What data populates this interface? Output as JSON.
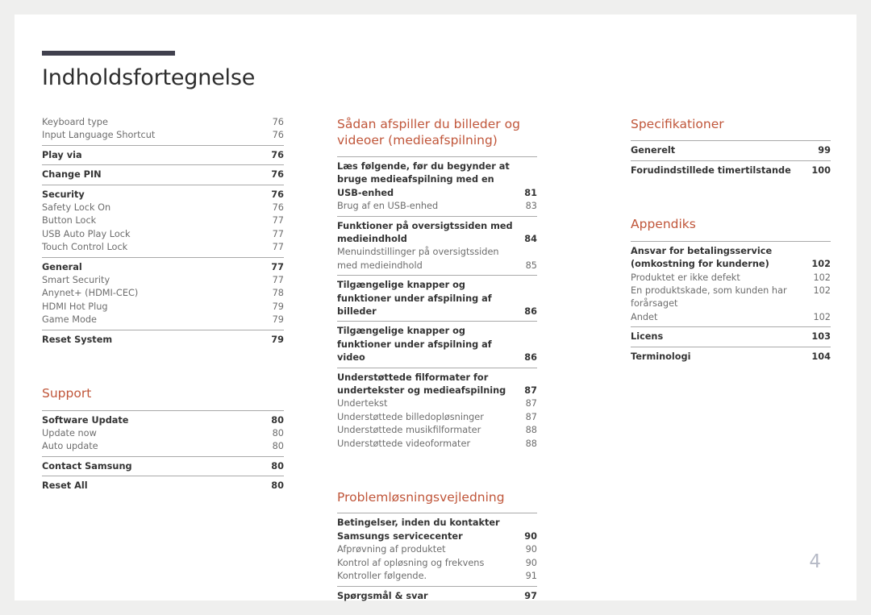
{
  "document": {
    "title": "Indholdsfortegnelse",
    "page_number": "4",
    "accent_color": "#c0563a",
    "rule_color": "#40404d",
    "page_number_color": "#b6bac6"
  },
  "columns": {
    "left": {
      "sections": [
        {
          "heading": null,
          "groups": [
            {
              "rule": false,
              "entries": [
                {
                  "level": 2,
                  "label": "Keyboard type",
                  "page": "76"
                },
                {
                  "level": 2,
                  "label": "Input Language Shortcut",
                  "page": "76"
                }
              ]
            },
            {
              "rule": true,
              "entries": [
                {
                  "level": 1,
                  "label": "Play via",
                  "page": "76"
                }
              ]
            },
            {
              "rule": true,
              "entries": [
                {
                  "level": 1,
                  "label": "Change PIN",
                  "page": "76"
                }
              ]
            },
            {
              "rule": true,
              "entries": [
                {
                  "level": 1,
                  "label": "Security",
                  "page": "76"
                },
                {
                  "level": 2,
                  "label": "Safety Lock On",
                  "page": "76"
                },
                {
                  "level": 2,
                  "label": "Button Lock",
                  "page": "77"
                },
                {
                  "level": 2,
                  "label": "USB Auto Play Lock",
                  "page": "77"
                },
                {
                  "level": 2,
                  "label": "Touch Control Lock",
                  "page": "77"
                }
              ]
            },
            {
              "rule": true,
              "entries": [
                {
                  "level": 1,
                  "label": "General",
                  "page": "77"
                },
                {
                  "level": 2,
                  "label": "Smart Security",
                  "page": "77"
                },
                {
                  "level": 2,
                  "label": "Anynet+ (HDMI-CEC)",
                  "page": "78"
                },
                {
                  "level": 2,
                  "label": "HDMI Hot Plug",
                  "page": "79"
                },
                {
                  "level": 2,
                  "label": "Game Mode",
                  "page": "79"
                }
              ]
            },
            {
              "rule": true,
              "entries": [
                {
                  "level": 1,
                  "label": "Reset System",
                  "page": "79"
                }
              ]
            }
          ]
        },
        {
          "heading": "Support",
          "groups": [
            {
              "rule": true,
              "entries": [
                {
                  "level": 1,
                  "label": "Software Update",
                  "page": "80"
                },
                {
                  "level": 2,
                  "label": "Update now",
                  "page": "80"
                },
                {
                  "level": 2,
                  "label": "Auto update",
                  "page": "80"
                }
              ]
            },
            {
              "rule": true,
              "entries": [
                {
                  "level": 1,
                  "label": "Contact Samsung",
                  "page": "80"
                }
              ]
            },
            {
              "rule": true,
              "entries": [
                {
                  "level": 1,
                  "label": "Reset All",
                  "page": "80"
                }
              ]
            }
          ]
        }
      ]
    },
    "middle": {
      "sections": [
        {
          "heading": "Sådan afspiller du billeder og videoer (medieafspilning)",
          "groups": [
            {
              "rule": true,
              "entries": [
                {
                  "level": 1,
                  "label": "Læs følgende, før du begynder at bruge medieafspilning med en USB-enhed",
                  "page": "81",
                  "wrap": true
                },
                {
                  "level": 2,
                  "label": "Brug af en USB-enhed",
                  "page": "83"
                }
              ]
            },
            {
              "rule": true,
              "entries": [
                {
                  "level": 1,
                  "label": "Funktioner på oversigtssiden med medieindhold",
                  "page": "84",
                  "wrap": true
                },
                {
                  "level": 2,
                  "label": "Menuindstillinger på oversigtssiden med medieindhold",
                  "page": "85",
                  "wrap": true
                }
              ]
            },
            {
              "rule": true,
              "entries": [
                {
                  "level": 1,
                  "label": "Tilgængelige knapper og funktioner under afspilning af billeder",
                  "page": "86",
                  "wrap": true
                }
              ]
            },
            {
              "rule": true,
              "entries": [
                {
                  "level": 1,
                  "label": "Tilgængelige knapper og funktioner under afspilning af video",
                  "page": "86",
                  "wrap": true
                }
              ]
            },
            {
              "rule": true,
              "entries": [
                {
                  "level": 1,
                  "label": "Understøttede filformater for undertekster og medieafspilning",
                  "page": "87",
                  "wrap": true
                },
                {
                  "level": 2,
                  "label": "Undertekst",
                  "page": "87"
                },
                {
                  "level": 2,
                  "label": "Understøttede billedopløsninger",
                  "page": "87"
                },
                {
                  "level": 2,
                  "label": "Understøttede musikfilformater",
                  "page": "88"
                },
                {
                  "level": 2,
                  "label": "Understøttede videoformater",
                  "page": "88"
                }
              ]
            }
          ]
        },
        {
          "heading": "Problemløsningsvejledning",
          "groups": [
            {
              "rule": true,
              "entries": [
                {
                  "level": 1,
                  "label": "Betingelser, inden du kontakter Samsungs servicecenter",
                  "page": "90",
                  "wrap": true
                },
                {
                  "level": 2,
                  "label": "Afprøvning af produktet",
                  "page": "90"
                },
                {
                  "level": 2,
                  "label": "Kontrol af opløsning og frekvens",
                  "page": "90"
                },
                {
                  "level": 2,
                  "label": "Kontroller følgende.",
                  "page": "91"
                }
              ]
            },
            {
              "rule": true,
              "entries": [
                {
                  "level": 1,
                  "label": "Spørgsmål & svar",
                  "page": "97"
                }
              ]
            }
          ]
        }
      ]
    },
    "right": {
      "sections": [
        {
          "heading": "Specifikationer",
          "groups": [
            {
              "rule": true,
              "entries": [
                {
                  "level": 1,
                  "label": "Generelt",
                  "page": "99"
                }
              ]
            },
            {
              "rule": true,
              "entries": [
                {
                  "level": 1,
                  "label": "Forudindstillede timertilstande",
                  "page": "100"
                }
              ]
            }
          ]
        },
        {
          "heading": "Appendiks",
          "groups": [
            {
              "rule": true,
              "entries": [
                {
                  "level": 1,
                  "label": "Ansvar for betalingsservice (omkostning for kunderne)",
                  "page": "102",
                  "wrap": true
                },
                {
                  "level": 2,
                  "label": "Produktet er ikke defekt",
                  "page": "102"
                },
                {
                  "level": 2,
                  "label": "En produktskade, som kunden har forårsaget",
                  "page": "102",
                  "tight": true
                },
                {
                  "level": 2,
                  "label": "Andet",
                  "page": "102"
                }
              ]
            },
            {
              "rule": true,
              "entries": [
                {
                  "level": 1,
                  "label": "Licens",
                  "page": "103"
                }
              ]
            },
            {
              "rule": true,
              "entries": [
                {
                  "level": 1,
                  "label": "Terminologi",
                  "page": "104"
                }
              ]
            }
          ]
        }
      ]
    }
  }
}
